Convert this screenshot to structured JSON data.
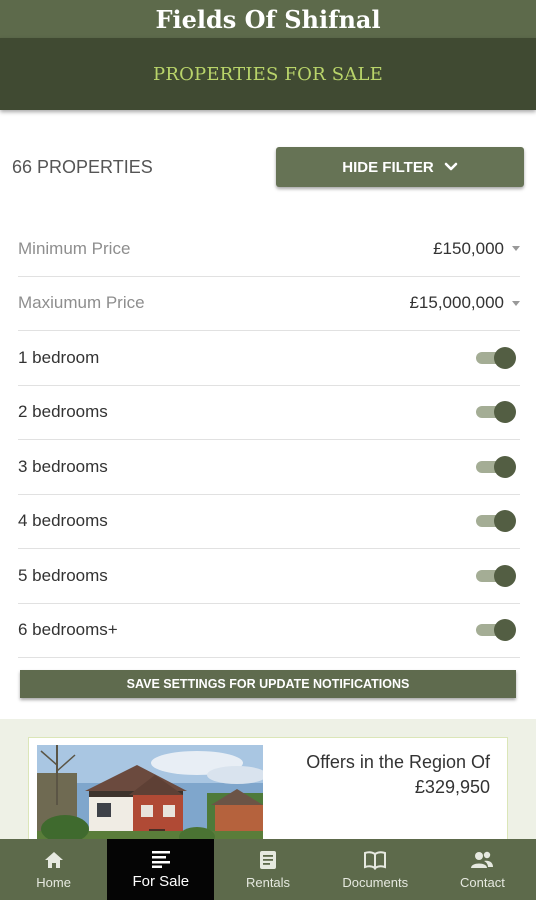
{
  "app": {
    "title": "Fields Of Shifnal"
  },
  "header": {
    "section_title": "PROPERTIES FOR SALE"
  },
  "filter": {
    "count_text": "66 PROPERTIES",
    "hide_label": "HIDE FILTER",
    "min_price": {
      "label": "Minimum Price",
      "value": "£150,000"
    },
    "max_price": {
      "label": "Maxiumum Price",
      "value": "£15,000,000"
    },
    "bedrooms": [
      {
        "label": "1 bedroom",
        "on": true
      },
      {
        "label": "2 bedrooms",
        "on": true
      },
      {
        "label": "3 bedrooms",
        "on": true
      },
      {
        "label": "4 bedrooms",
        "on": true
      },
      {
        "label": "5 bedrooms",
        "on": true
      },
      {
        "label": "6 bedrooms+",
        "on": true
      }
    ],
    "save_label": "SAVE SETTINGS FOR UPDATE NOTIFICATIONS"
  },
  "listing": {
    "price_prefix": "Offers in the Region Of",
    "price": "£329,950"
  },
  "nav": {
    "items": [
      {
        "label": "Home",
        "icon": "home-icon",
        "active": false
      },
      {
        "label": "For Sale",
        "icon": "list-icon",
        "active": true
      },
      {
        "label": "Rentals",
        "icon": "document-icon",
        "active": false
      },
      {
        "label": "Documents",
        "icon": "book-icon",
        "active": false
      },
      {
        "label": "Contact",
        "icon": "people-icon",
        "active": false
      }
    ]
  },
  "colors": {
    "title_bar": "#5d6a4b",
    "header": "#404a32",
    "header_text": "#b9d46a",
    "button": "#667355",
    "toggle_knob": "#535e43",
    "nav_active": "#050505"
  }
}
